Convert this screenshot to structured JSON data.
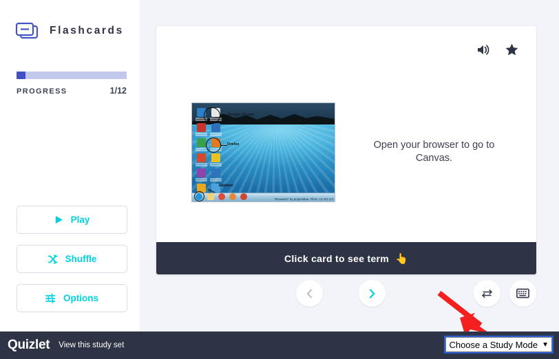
{
  "sidebar": {
    "brand_title": "Flashcards",
    "brand_icon": "flashcards-stack-icon",
    "progress": {
      "label": "PROGRESS",
      "count": "1/12",
      "current": 1,
      "total": 12,
      "percent": 8.3,
      "fill_color": "#3f51c5",
      "track_color": "#c2c8ec"
    },
    "buttons": [
      {
        "label": "Play",
        "icon": "play-icon"
      },
      {
        "label": "Shuffle",
        "icon": "shuffle-icon"
      },
      {
        "label": "Options",
        "icon": "sliders-icon"
      }
    ],
    "accent_color": "#00d2e0"
  },
  "card": {
    "audio_icon": "speaker-icon",
    "star_icon": "star-icon",
    "definition_text": "Open your browser to go to Canvas.",
    "image": {
      "alt": "desktop-screenshot",
      "caption": "\"Browsers\" by projectidea, Flickr, CC BY 2.0",
      "annotations": [
        "Google Chrome",
        "Firefox",
        "Explorer"
      ]
    },
    "footer_label": "Click card to see term",
    "footer_emoji": "👆",
    "footer_color": "#2e3445"
  },
  "controls": {
    "prev": {
      "icon": "chevron-left-icon",
      "enabled": false
    },
    "next": {
      "icon": "chevron-right-icon",
      "enabled": true
    },
    "flip": {
      "icon": "flip-arrows-icon"
    },
    "keyboard": {
      "icon": "keyboard-icon"
    }
  },
  "annotation": {
    "arrow_color": "#f42020",
    "points_to": "study-mode-dropdown"
  },
  "bottombar": {
    "logo": "Quizlet",
    "view_link": "View this study set",
    "study_mode_value": "Choose a Study Mode",
    "caret": "▼",
    "background": "#2e3445",
    "focus_outline_color": "#2a5fd6"
  }
}
